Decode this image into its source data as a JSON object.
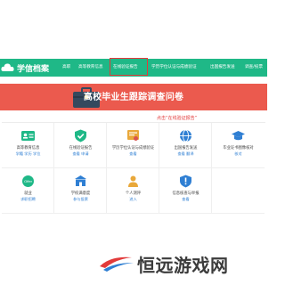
{
  "nav": {
    "logo_text": "学信档案",
    "items": [
      "高职",
      "高等教育信息",
      "在线验证报告",
      "学历学位认证与成绩验证",
      "出国报告发送",
      "调查/投票"
    ]
  },
  "banner": {
    "title": "高校毕业生跟踪调查问卷"
  },
  "caption": "点击“在线验证报告”",
  "services": [
    {
      "title": "高等教育信息",
      "links": "学籍 学历 学位",
      "icon": "id-card-icon",
      "color": "#1fb887"
    },
    {
      "title": "在线验证报告",
      "links": "查看 申请",
      "icon": "shield-check-icon",
      "color": "#1fb887"
    },
    {
      "title": "学历学位认证与成绩验证",
      "links": "查看",
      "icon": "certificate-icon",
      "color": "#e9a83a"
    },
    {
      "title": "出国报告发送",
      "links": "查看 翻译",
      "icon": "globe-icon",
      "color": "#2f7fd3"
    },
    {
      "title": "毕业证书图像核对",
      "links": "核对",
      "icon": "graduation-cap-icon",
      "color": "#2f7fd3"
    },
    {
      "title": "就业",
      "links": "求职招聘",
      "icon": "offer-icon",
      "color": "#1fb887"
    },
    {
      "title": "学校满意度",
      "links": "参与投票",
      "icon": "school-icon",
      "color": "#2f7fd3"
    },
    {
      "title": "个人测评",
      "links": "进入",
      "icon": "person-icon",
      "color": "#e9a83a"
    },
    {
      "title": "信息核查与举报",
      "links": "查看",
      "icon": "report-shield-icon",
      "color": "#2f7fd3"
    }
  ],
  "watermark": {
    "text": "恒远游戏网"
  }
}
